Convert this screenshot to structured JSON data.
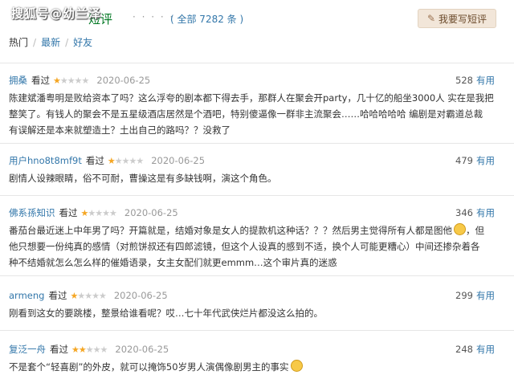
{
  "watermark": "搜狐号@幼兰泽",
  "header": {
    "title": "短评",
    "dots": "· · · · · ·",
    "count": "( 全部 7282 条 )",
    "write_button": "我要写短评"
  },
  "tabs": {
    "hot": "热门",
    "sep1": "/",
    "latest": "最新",
    "sep2": "/",
    "friends": "好友"
  },
  "colors": {
    "link": "#3377aa",
    "star": "#f5a623",
    "button_bg": "#f2e6d9"
  },
  "reviews": [
    {
      "user": "拥桑",
      "status": "看过",
      "rating": 1,
      "date": "2020-06-25",
      "votes": "528",
      "useful": "有用",
      "lines": [
        "陈建斌潘粤明是败给资本了吗？这么浮夸的剧本都下得去手，那群人在聚会开party，几十亿的船坐3000人 实在是我把",
        "整笑了。有钱人的聚会不是五星级酒店居然是个酒吧，特别傻逼像一群非主流聚会……哈哈哈哈哈 编剧是对霸道总裁",
        "有误解还是本来就塑造土？土出自己的路吗？？没救了"
      ]
    },
    {
      "user": "用户hno8t8mf9t",
      "status": "看过",
      "rating": 1,
      "date": "2020-06-25",
      "votes": "479",
      "useful": "有用",
      "lines": [
        "剧情人设辣眼睛，俗不可耐，曹操这是有多缺钱啊，演这个角色。"
      ]
    },
    {
      "user": "佛系孫知识",
      "status": "看过",
      "rating": 1,
      "date": "2020-06-25",
      "votes": "346",
      "useful": "有用",
      "lines": [
        "番茄台最近迷上中年男了吗？开篇就是，结婚对象是女人的提款机这种话？？？然后男主觉得所有人都是图他",
        "他只想要一份纯真的感情（对煎饼叔还有四郎滤镜，但这个人设真的感到不适，换个人可能更糟心）中间还掺杂着各",
        "种不结婚就怎么怎么样的催婚语录，女主女配们就更emmm…这个审片真的迷惑"
      ],
      "emoji_suffix": "，但"
    },
    {
      "user": "armeng",
      "status": "看过",
      "rating": 1,
      "date": "2020-06-25",
      "votes": "299",
      "useful": "有用",
      "lines": [
        "刚看到这女的要跳楼，整景给谁看呢？哎…七十年代武侠烂片都没这么拍的。"
      ]
    },
    {
      "user": "复泛一舟",
      "status": "看过",
      "rating": 2,
      "date": "2020-06-25",
      "votes": "248",
      "useful": "有用",
      "lines": [
        "不是套个“轻喜剧”的外皮，就可以掩饰50岁男人演偶像剧男主的事实"
      ]
    }
  ]
}
